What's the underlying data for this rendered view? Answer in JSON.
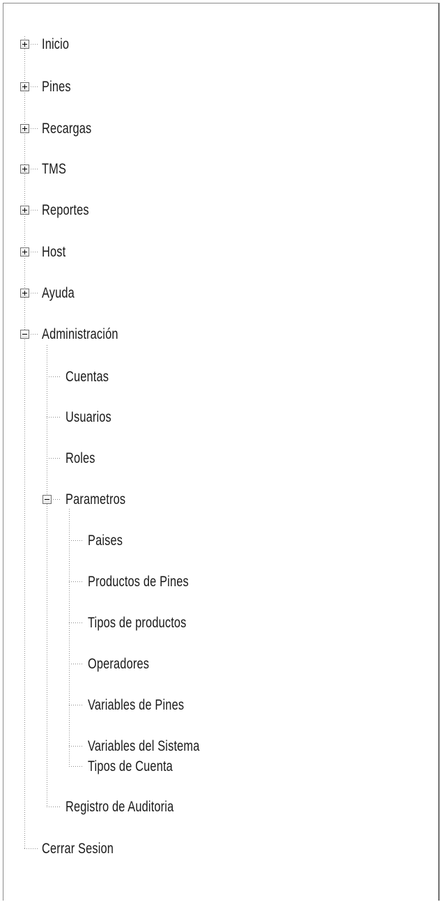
{
  "tree": {
    "inicio": {
      "label": "Inicio",
      "toggle": "plus-icon"
    },
    "pines": {
      "label": "Pines",
      "toggle": "plus-icon"
    },
    "recargas": {
      "label": "Recargas",
      "toggle": "plus-icon"
    },
    "tms": {
      "label": "TMS",
      "toggle": "plus-icon"
    },
    "reportes": {
      "label": "Reportes",
      "toggle": "plus-icon"
    },
    "host": {
      "label": "Host",
      "toggle": "plus-icon"
    },
    "ayuda": {
      "label": "Ayuda",
      "toggle": "plus-icon"
    },
    "administracion": {
      "label": "Administración",
      "toggle": "minus-icon",
      "children": {
        "cuentas": {
          "label": "Cuentas"
        },
        "usuarios": {
          "label": "Usuarios"
        },
        "roles": {
          "label": "Roles"
        },
        "parametros": {
          "label": "Parametros",
          "toggle": "minus-icon",
          "children": {
            "paises": {
              "label": "Paises"
            },
            "productos_pines": {
              "label": "Productos de Pines"
            },
            "tipos_productos": {
              "label": "Tipos de productos"
            },
            "operadores": {
              "label": "Operadores"
            },
            "variables_pines": {
              "label": "Variables de Pines"
            },
            "variables_sistema": {
              "label": "Variables del Sistema"
            },
            "tipos_cuenta": {
              "label": "Tipos de Cuenta"
            }
          }
        },
        "registro_auditoria": {
          "label": "Registro de Auditoria"
        }
      }
    },
    "cerrar_sesion": {
      "label": "Cerrar Sesion"
    }
  },
  "colors": {
    "line": "#8c8c8c",
    "border": "#8a8a8a",
    "text": "#1a1a1a"
  }
}
